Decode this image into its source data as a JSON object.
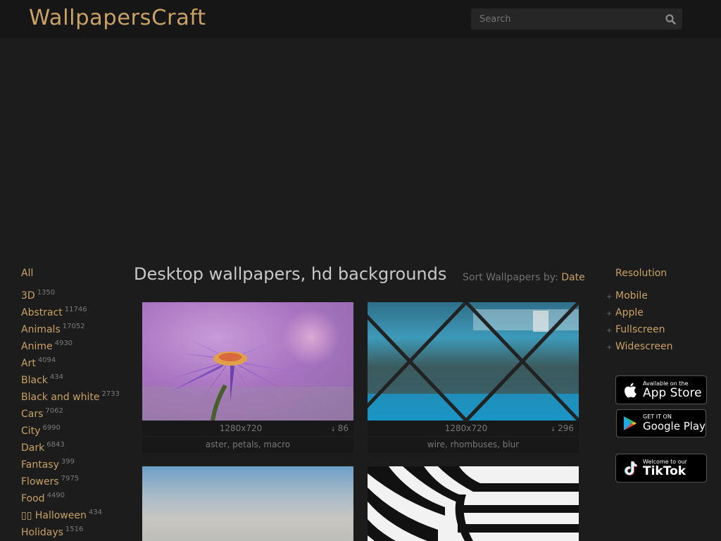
{
  "header": {
    "logo": "WallpapersCraft",
    "search_placeholder": "Search",
    "search_icon": "search-icon"
  },
  "sidebar": {
    "all_label": "All",
    "categories": [
      {
        "label": "3D",
        "count": "1350"
      },
      {
        "label": "Abstract",
        "count": "11746"
      },
      {
        "label": "Animals",
        "count": "17052"
      },
      {
        "label": "Anime",
        "count": "4930"
      },
      {
        "label": "Art",
        "count": "4094"
      },
      {
        "label": "Black",
        "count": "434"
      },
      {
        "label": "Black and white",
        "count": "2733"
      },
      {
        "label": "Cars",
        "count": "7062"
      },
      {
        "label": "City",
        "count": "6990"
      },
      {
        "label": "Dark",
        "count": "6843"
      },
      {
        "label": "Fantasy",
        "count": "399"
      },
      {
        "label": "Flowers",
        "count": "7975"
      },
      {
        "label": "Food",
        "count": "4490"
      },
      {
        "label": "▯▯ Halloween",
        "count": "434"
      },
      {
        "label": "Holidays",
        "count": "1516"
      }
    ]
  },
  "main": {
    "title": "Desktop wallpapers, hd backgrounds",
    "sort_label": "Sort Wallpapers by:",
    "sort_value": "Date",
    "cards": [
      {
        "resolution": "1280x720",
        "downloads": "86",
        "tags": "aster, petals, macro"
      },
      {
        "resolution": "1280x720",
        "downloads": "296",
        "tags": "wire, rhombuses, blur"
      },
      {
        "resolution": "",
        "downloads": "",
        "tags": ""
      },
      {
        "resolution": "",
        "downloads": "",
        "tags": ""
      }
    ]
  },
  "right": {
    "resolution_title": "Resolution",
    "items": [
      "Mobile",
      "Apple",
      "Fullscreen",
      "Widescreen"
    ],
    "badges": {
      "appstore_small": "Available on the",
      "appstore_big": "App Store",
      "googleplay_small": "GET IT ON",
      "googleplay_big": "Google Play",
      "tiktok_small": "Welcome to our",
      "tiktok_big": "TikTok"
    }
  },
  "colors": {
    "accent": "#c8a163",
    "background": "#1c1c1c",
    "header": "#161616"
  }
}
